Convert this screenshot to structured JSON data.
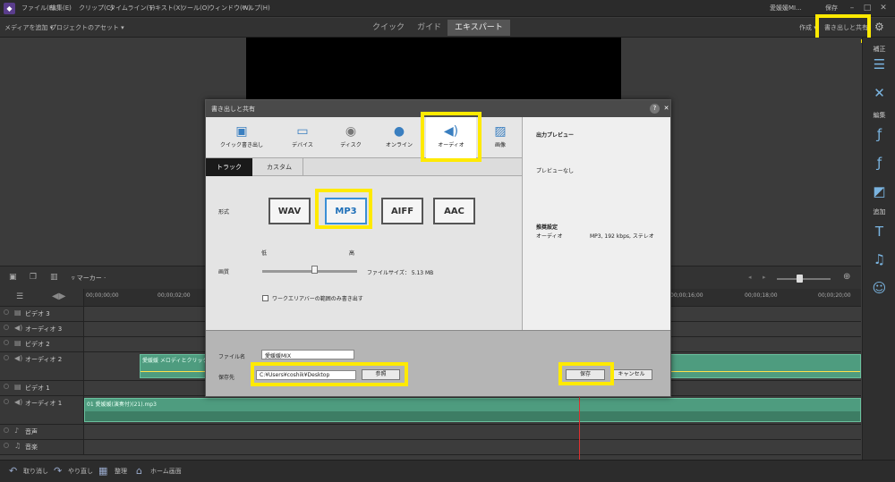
{
  "menu": [
    "ファイル(F)",
    "編集(E)",
    "クリップ(C)",
    "タイムライン(T)",
    "テキスト(X)",
    "ツール(O)",
    "ウィンドウ(W)",
    "ヘルプ(H)"
  ],
  "menu_right": {
    "user": "愛媛媛MI...",
    "save": "保存"
  },
  "toolbar": {
    "add_media": "メディアを追加 ▾",
    "project_assets": "プロジェクトのアセット ▾",
    "modes": [
      "クイック",
      "ガイド",
      "エキスパート"
    ],
    "create": "作成 ▾",
    "export_share": "書き出しと共有"
  },
  "rightbar": {
    "adjust": "補正",
    "edit": "編集",
    "add": "追加"
  },
  "timeline": {
    "marker": "マーカー ·",
    "ticks": [
      "00;00;00;00",
      "00;00;02;00",
      "00;00;16;00",
      "00;00;18;00",
      "00;00;20;00"
    ],
    "tracks": [
      {
        "name": "ビデオ 3",
        "icon": "▤"
      },
      {
        "name": "オーディオ 3",
        "icon": "◀)"
      },
      {
        "name": "ビデオ 2",
        "icon": "▤"
      },
      {
        "name": "オーディオ 2",
        "icon": "◀)"
      },
      {
        "name": "ビデオ 1",
        "icon": "▤"
      },
      {
        "name": "オーディオ 1",
        "icon": "◀)"
      },
      {
        "name": "音声",
        "icon": "♪"
      },
      {
        "name": "音楽",
        "icon": "♫"
      }
    ],
    "clip_audio2": "愛媛媛 メロディとクリック.wav",
    "clip_audio1": "01 愛媛媛(演奏付)(21).mp3"
  },
  "bottombar": {
    "undo": "取り消し",
    "redo": "やり直し",
    "organize": "整理",
    "home": "ホーム画面"
  },
  "dialog": {
    "title": "書き出しと共有",
    "categories": [
      "クイック書き出し",
      "デバイス",
      "ディスク",
      "オンライン",
      "オーディオ",
      "画像"
    ],
    "subtabs": [
      "トラック",
      "カスタム"
    ],
    "format_label": "形式",
    "formats": [
      "WAV",
      "MP3",
      "AIFF",
      "AAC"
    ],
    "quality_label": "画質",
    "quality_low": "低",
    "quality_high": "高",
    "quality_value": 0.55,
    "filesize": "ファイルサイズ： 5.13 MB",
    "workarea_only": "ワークエリアバーの範囲のみ書き出す",
    "preview_title": "出力プレビュー",
    "preview_none": "プレビューなし",
    "preset_title": "推奨設定",
    "preset_type": "オーディオ",
    "preset_value": "MP3, 192 kbps, ステレオ",
    "filename_label": "ファイル名",
    "filename_value": "愛媛媛MIX",
    "saveto_label": "保存先",
    "saveto_value": "C:¥Users¥coshik¥Desktop",
    "browse": "参照",
    "save": "保存",
    "cancel": "キャンセル"
  }
}
